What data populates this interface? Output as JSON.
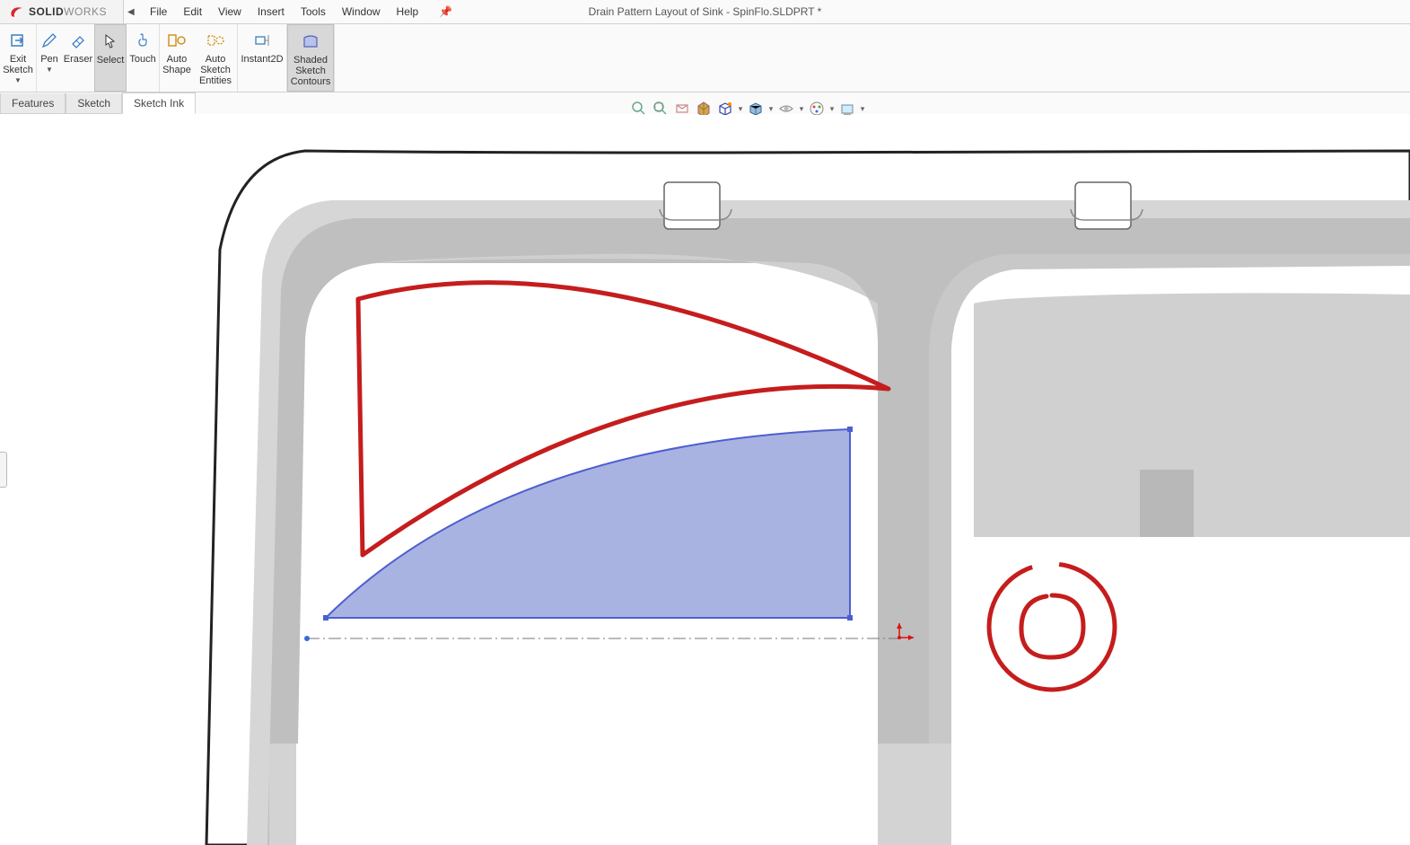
{
  "app": {
    "logo_s": "S",
    "logo_solid": "SOLID",
    "logo_works": "WORKS",
    "document_title": "Drain Pattern Layout  of Sink - SpinFlo.SLDPRT *"
  },
  "menus": {
    "file": "File",
    "edit": "Edit",
    "view": "View",
    "insert": "Insert",
    "tools": "Tools",
    "window": "Window",
    "help": "Help"
  },
  "ribbon": {
    "exit_sketch": "Exit\nSketch",
    "pen": "Pen",
    "eraser": "Eraser",
    "select": "Select",
    "touch": "Touch",
    "auto_shape": "Auto\nShape",
    "auto_sketch_entities": "Auto\nSketch\nEntities",
    "instant2d": "Instant2D",
    "shaded_sketch_contours": "Shaded\nSketch\nContours"
  },
  "tabs": {
    "features": "Features",
    "sketch": "Sketch",
    "sketch_ink": "Sketch Ink"
  },
  "hud": {
    "zoom_window": "zoom-to-fit",
    "zoom_prev": "zoom-area",
    "zoom_section": "section-view",
    "view_orient": "view-orientation",
    "display_style": "display-style",
    "hide_show": "hide-show-items",
    "edit_appearance": "edit-appearance",
    "apply_scene": "apply-scene",
    "view_settings": "view-settings"
  },
  "colors": {
    "stroke_red": "#c51d1d",
    "stroke_blue": "#4d5fd0",
    "fill_blue": "#a9b3e2",
    "part_grey": "#d6d6d6",
    "dark_grey": "#a3a3a3",
    "centerline": "#777"
  }
}
